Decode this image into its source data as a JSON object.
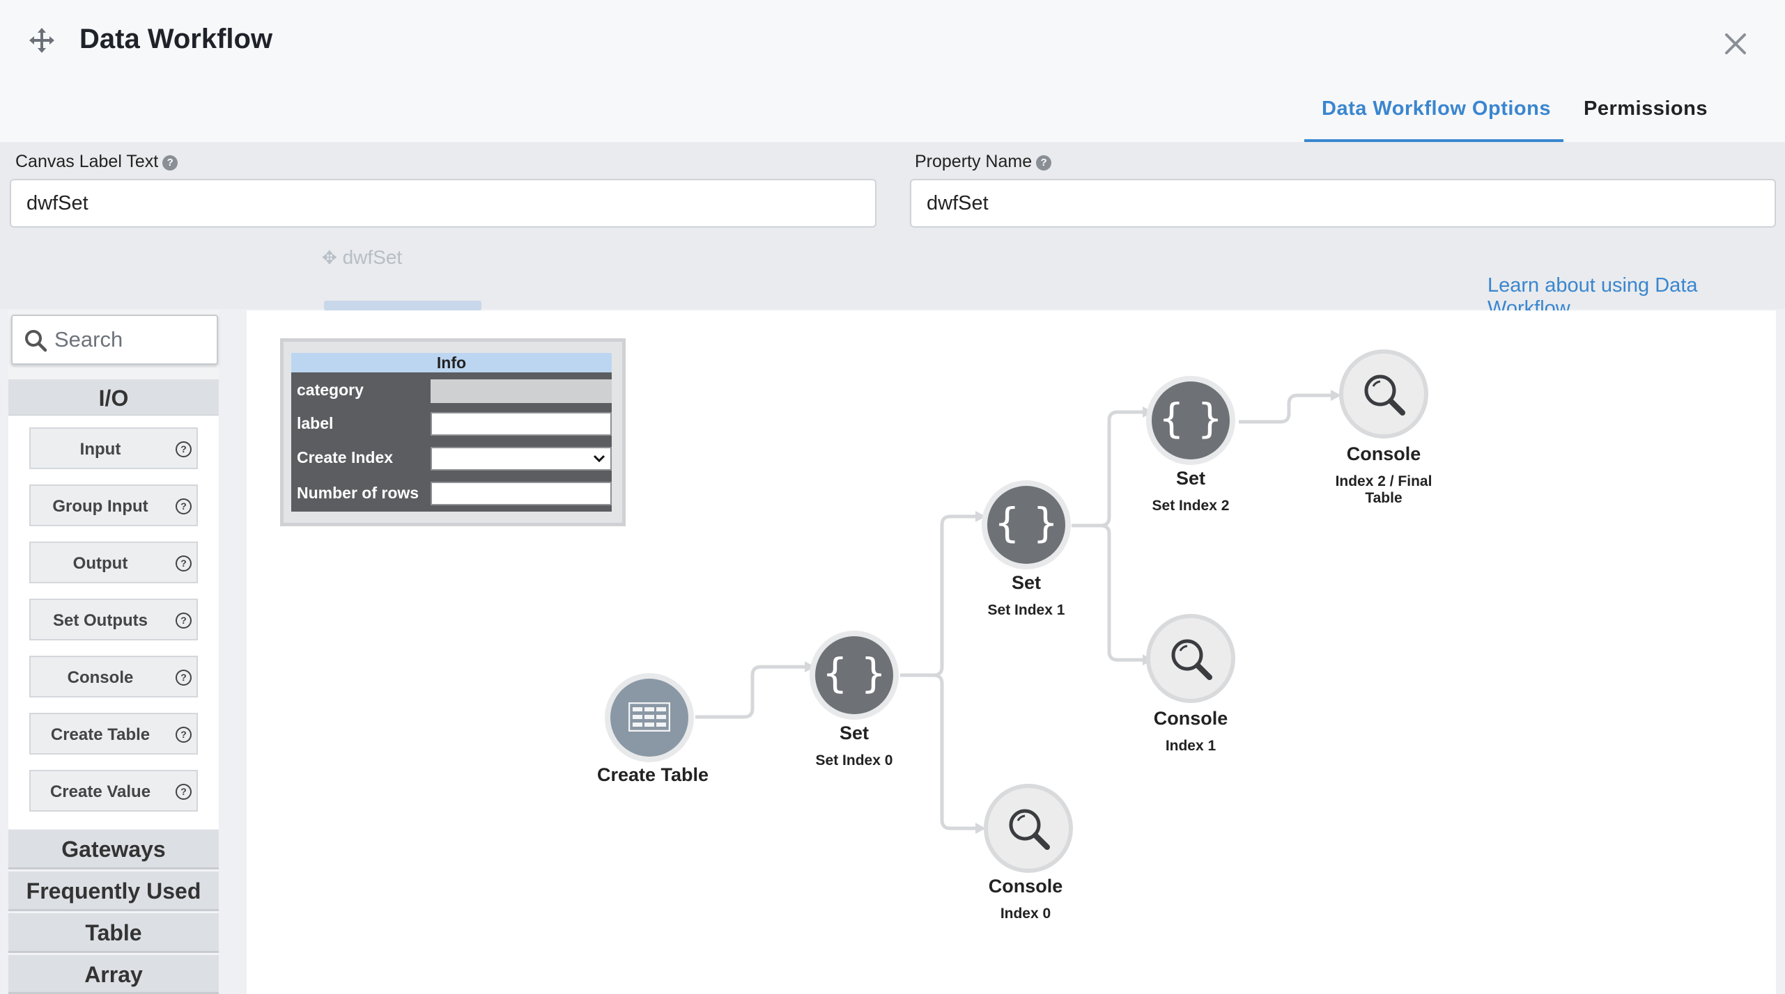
{
  "header": {
    "title": "Data Workflow",
    "tabs": [
      {
        "label": "Data Workflow Options",
        "active": true
      },
      {
        "label": "Permissions",
        "active": false
      }
    ],
    "accent_color": "#3a86cf"
  },
  "form": {
    "canvas_label": {
      "label": "Canvas Label Text",
      "value": "dwfSet"
    },
    "property_name": {
      "label": "Property Name",
      "value": "dwfSet"
    },
    "learn_link": "Learn about using Data Workflow",
    "background_ghost_text": [
      "dwfSet"
    ]
  },
  "sidebar": {
    "search_placeholder": "Search",
    "sections": [
      "I/O",
      "Gateways",
      "Frequently Used",
      "Table",
      "Array"
    ],
    "io_items": [
      "Input",
      "Group Input",
      "Output",
      "Set Outputs",
      "Console",
      "Create Table",
      "Create Value"
    ]
  },
  "info_panel": {
    "title": "Info",
    "rows": [
      "category",
      "label",
      "Create Index",
      "Number of rows"
    ]
  },
  "nodes": [
    {
      "id": "create_table",
      "type": "Create Table",
      "label": ""
    },
    {
      "id": "set0",
      "type": "Set",
      "label": "Set Index 0"
    },
    {
      "id": "console0",
      "type": "Console",
      "label": "Index 0"
    },
    {
      "id": "set1",
      "type": "Set",
      "label": "Set Index 1"
    },
    {
      "id": "console1",
      "type": "Console",
      "label": "Index 1"
    },
    {
      "id": "set2",
      "type": "Set",
      "label": "Set Index 2"
    },
    {
      "id": "console2",
      "type": "Console",
      "label": "Index 2 / Final Table"
    }
  ],
  "connections": [
    [
      "create_table",
      "set0"
    ],
    [
      "set0",
      "set1"
    ],
    [
      "set0",
      "console0"
    ],
    [
      "set1",
      "set2"
    ],
    [
      "set1",
      "console1"
    ],
    [
      "set2",
      "console2"
    ]
  ]
}
